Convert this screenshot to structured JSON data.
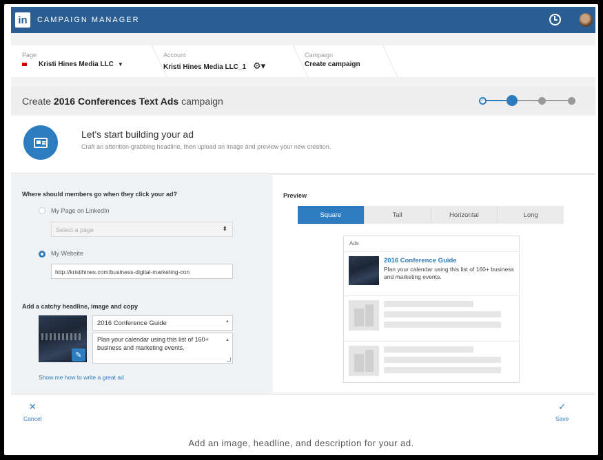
{
  "app": {
    "logo": "in",
    "title": "CAMPAIGN MANAGER"
  },
  "breadcrumb": [
    {
      "label": "Page",
      "value": "Kristi Hines Media LLC"
    },
    {
      "label": "Account",
      "value": "Kristi Hines Media LLC_1"
    },
    {
      "label": "Campaign",
      "value": "Create campaign"
    }
  ],
  "campaign": {
    "prefix": "Create",
    "name": "2016 Conferences Text Ads",
    "suffix": "campaign",
    "current_step": 2,
    "total_steps": 4
  },
  "intro": {
    "title": "Let's start building your ad",
    "subtitle": "Craft an attention-grabbing headline, then upload an image and preview your new creation."
  },
  "form": {
    "destination_question": "Where should members go when they click your ad?",
    "option_page": "My Page on LinkedIn",
    "page_select_placeholder": "Select a page",
    "option_website": "My Website",
    "website_url": "http://kristihines.com/business-digital-marketing-con",
    "selected_option": "website",
    "copy_heading": "Add a catchy headline, image and copy",
    "headline_value": "2016 Conference Guide",
    "description_value": "Plan your calendar using this list of 160+ business and marketing events.",
    "help_link": "Show me how to write a great ad"
  },
  "preview": {
    "title": "Preview",
    "tabs": [
      "Square",
      "Tall",
      "Horizontal",
      "Long"
    ],
    "active_tab": "Square",
    "ads_label": "Ads",
    "ad_headline": "2016 Conference Guide",
    "ad_body": "Plan your calendar using this list of 160+ business and marketing events."
  },
  "footer": {
    "cancel": "Cancel",
    "save": "Save"
  },
  "caption": "Add an image, headline, and description for your ad.",
  "colors": {
    "brand": "#2b5f93",
    "accent": "#2e7cc0"
  }
}
